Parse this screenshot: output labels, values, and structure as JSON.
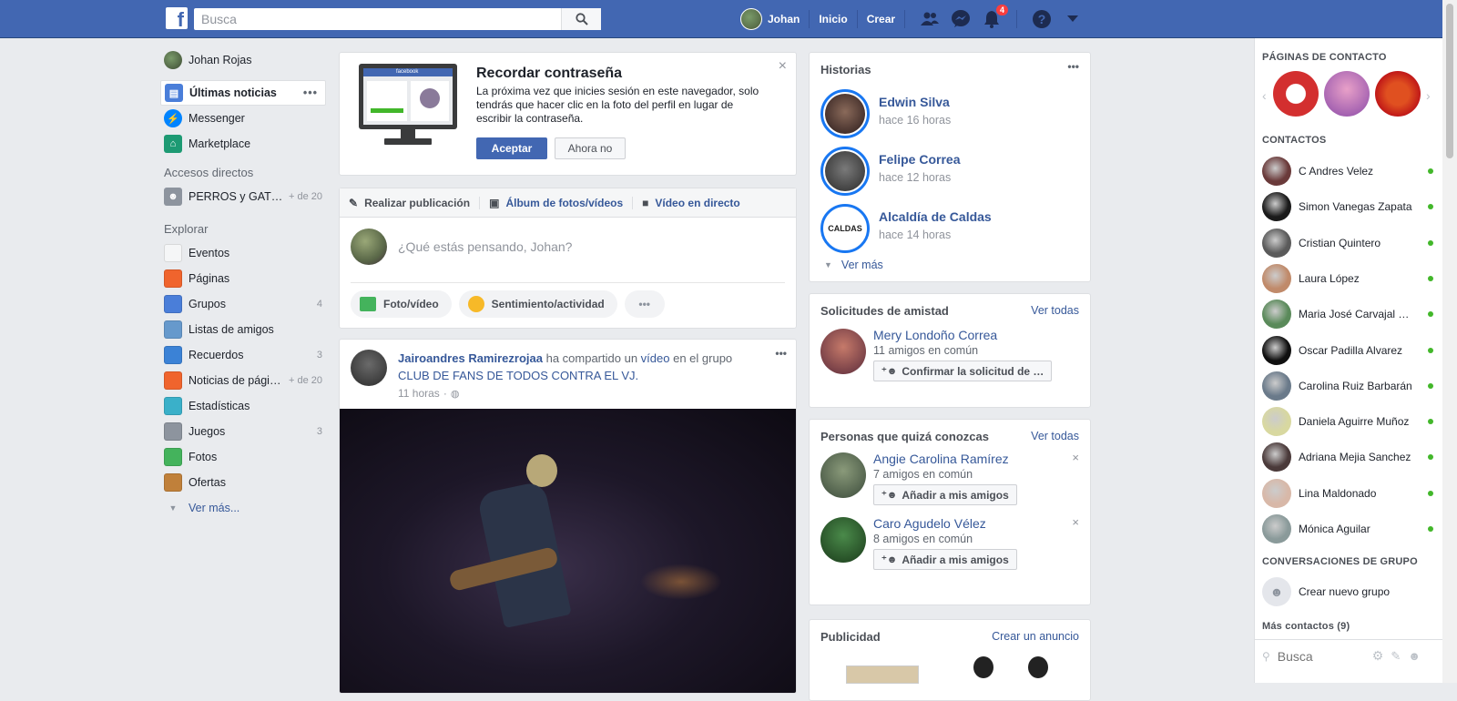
{
  "topbar": {
    "logo": "f",
    "search_placeholder": "Busca",
    "user_name": "Johan",
    "home_label": "Inicio",
    "create_label": "Crear",
    "notifications_count": "4"
  },
  "leftnav": {
    "profile_name": "Johan Rojas",
    "main_items": [
      {
        "label": "Últimas noticias",
        "icon": "news-feed-icon"
      },
      {
        "label": "Messenger",
        "icon": "messenger-icon"
      },
      {
        "label": "Marketplace",
        "icon": "marketplace-icon"
      }
    ],
    "shortcuts_title": "Accesos directos",
    "shortcut": {
      "label": "PERROS y GAT…",
      "count": "+ de 20"
    },
    "explore_title": "Explorar",
    "explore_items": [
      {
        "label": "Eventos",
        "count": "",
        "icon": "calendar-icon",
        "color": "#f5f6f7"
      },
      {
        "label": "Páginas",
        "count": "",
        "icon": "flag-icon",
        "color": "#f0642d"
      },
      {
        "label": "Grupos",
        "count": "4",
        "icon": "groups-icon",
        "color": "#4a7ed9"
      },
      {
        "label": "Listas de amigos",
        "count": "",
        "icon": "friend-list-icon",
        "color": "#6699cc"
      },
      {
        "label": "Recuerdos",
        "count": "3",
        "icon": "clock-icon",
        "color": "#3b82d6"
      },
      {
        "label": "Noticias de pági…",
        "count": "+ de 20",
        "icon": "pages-feed-icon",
        "color": "#f0642d"
      },
      {
        "label": "Estadísticas",
        "count": "",
        "icon": "cube-icon",
        "color": "#3ab0c9"
      },
      {
        "label": "Juegos",
        "count": "3",
        "icon": "gamepad-icon",
        "color": "#8d949e"
      },
      {
        "label": "Fotos",
        "count": "",
        "icon": "photos-icon",
        "color": "#44b35c"
      },
      {
        "label": "Ofertas",
        "count": "",
        "icon": "offers-icon",
        "color": "#c0803a"
      }
    ],
    "see_more": "Ver más..."
  },
  "password_card": {
    "title": "Recordar contraseña",
    "body": "La próxima vez que inicies sesión en este navegador, solo tendrás que hacer clic en la foto del perfil en lugar de escribir la contraseña.",
    "accept": "Aceptar",
    "decline": "Ahora no",
    "mock_brand": "facebook"
  },
  "composer": {
    "tabs": [
      "Realizar publicación",
      "Álbum de fotos/vídeos",
      "Vídeo en directo"
    ],
    "placeholder": "¿Qué estás pensando, Johan?",
    "actions": [
      "Foto/vídeo",
      "Sentimiento/actividad"
    ]
  },
  "post": {
    "author": "Jairoandres Ramirezrojaa",
    "text_1": "ha compartido un",
    "video_word": "vídeo",
    "text_2": "en el grupo",
    "group": "CLUB DE FANS DE TODOS CONTRA EL VJ.",
    "time": "11 horas"
  },
  "stories": {
    "title": "Historias",
    "items": [
      {
        "name": "Edwin Silva",
        "time": "hace 16 horas"
      },
      {
        "name": "Felipe Correa",
        "time": "hace 12 horas"
      },
      {
        "name": "Alcaldía de Caldas",
        "time": "hace 14 horas",
        "logo_text": "CALDAS"
      }
    ],
    "see_more": "Ver más"
  },
  "friend_requests": {
    "title": "Solicitudes de amistad",
    "see_all": "Ver todas",
    "name": "Mery Londoño Correa",
    "mutual": "11 amigos en común",
    "confirm": "Confirmar la solicitud de …"
  },
  "pymk": {
    "title": "Personas que quizá conozcas",
    "see_all": "Ver todas",
    "people": [
      {
        "name": "Angie Carolina Ramírez",
        "mutual": "7 amigos en común",
        "button": "Añadir a mis amigos"
      },
      {
        "name": "Caro Agudelo Vélez",
        "mutual": "8 amigos en común",
        "button": "Añadir a mis amigos"
      }
    ]
  },
  "ads": {
    "title": "Publicidad",
    "create": "Crear un anuncio"
  },
  "chat": {
    "pages_title": "Páginas de contacto",
    "contacts_title": "Contactos",
    "contacts": [
      "C Andres Velez",
      "Simon Vanegas Zapata",
      "Cristian Quintero",
      "Laura López",
      "Maria José Carvajal …",
      "Oscar Padilla Alvarez",
      "Carolina Ruiz Barbarán",
      "Daniela Aguirre Muñoz",
      "Adriana Mejia Sanchez",
      "Lina Maldonado",
      "Mónica Aguilar"
    ],
    "group_title": "Conversaciones de grupo",
    "new_group": "Crear nuevo grupo",
    "more_contacts": "Más contactos (9)",
    "search_placeholder": "Busca"
  }
}
